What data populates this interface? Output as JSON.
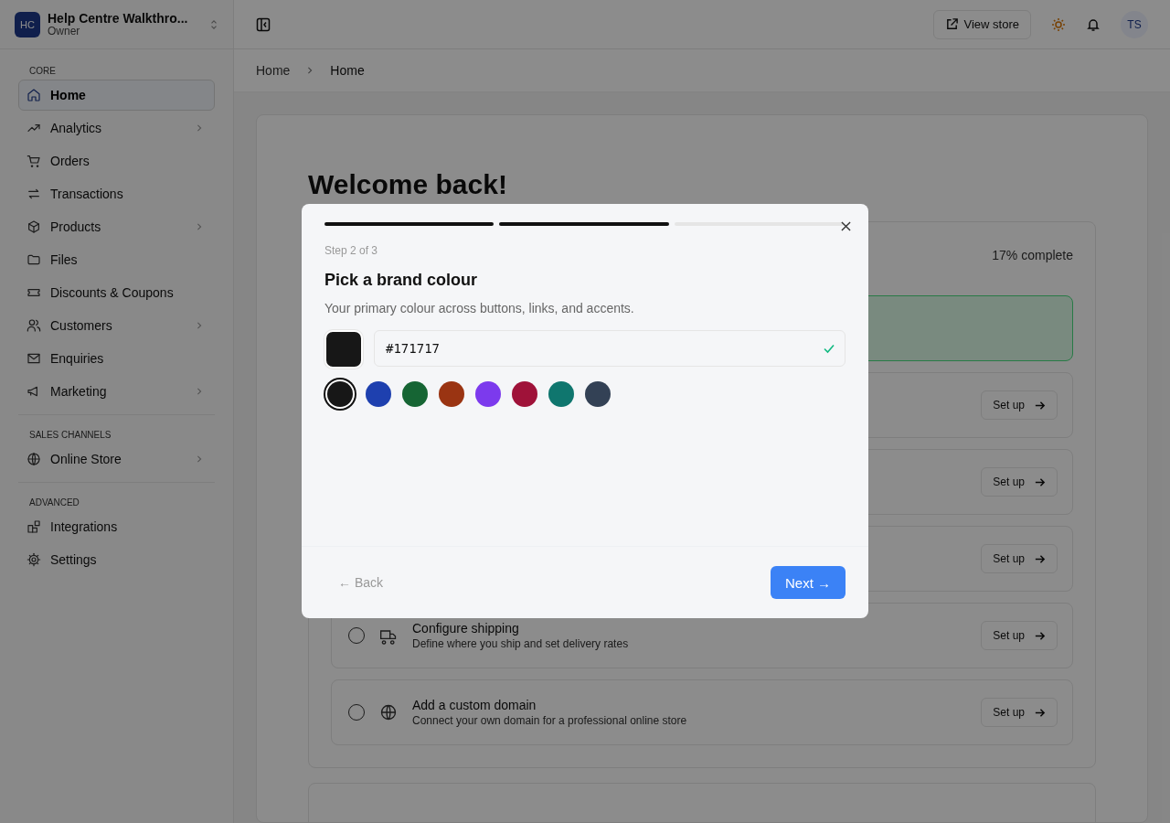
{
  "workspace": {
    "initials": "HC",
    "name": "Help Centre Walkthro...",
    "role": "Owner"
  },
  "sidebar": {
    "sections": [
      {
        "label": "CORE",
        "items": [
          {
            "label": "Home",
            "selected": true,
            "expandable": false
          },
          {
            "label": "Analytics",
            "selected": false,
            "expandable": true
          },
          {
            "label": "Orders",
            "selected": false,
            "expandable": false
          },
          {
            "label": "Transactions",
            "selected": false,
            "expandable": false
          },
          {
            "label": "Products",
            "selected": false,
            "expandable": true
          },
          {
            "label": "Files",
            "selected": false,
            "expandable": false
          },
          {
            "label": "Discounts & Coupons",
            "selected": false,
            "expandable": false
          },
          {
            "label": "Customers",
            "selected": false,
            "expandable": true
          },
          {
            "label": "Enquiries",
            "selected": false,
            "expandable": false
          },
          {
            "label": "Marketing",
            "selected": false,
            "expandable": true
          }
        ]
      },
      {
        "label": "SALES CHANNELS",
        "items": [
          {
            "label": "Online Store",
            "selected": false,
            "expandable": true
          }
        ]
      },
      {
        "label": "ADVANCED",
        "items": [
          {
            "label": "Integrations",
            "selected": false,
            "expandable": false
          },
          {
            "label": "Settings",
            "selected": false,
            "expandable": false
          }
        ]
      }
    ]
  },
  "header": {
    "view_store": "View store",
    "avatar": "TS"
  },
  "breadcrumb": [
    "Home",
    "Home"
  ],
  "main": {
    "title": "Welcome back!",
    "progress_text": "17% complete",
    "tasks": [
      {
        "done": true
      },
      {
        "done": false,
        "button": "Set up"
      },
      {
        "done": false,
        "button": "Set up"
      },
      {
        "done": false,
        "button": "Set up"
      },
      {
        "done": false,
        "title": "Configure shipping",
        "description": "Define where you ship and set delivery rates",
        "button": "Set up"
      },
      {
        "done": false,
        "title": "Add a custom domain",
        "description": "Connect your own domain for a professional online store",
        "button": "Set up"
      }
    ]
  },
  "dialog": {
    "steps": [
      {
        "filled": true
      },
      {
        "filled": true
      },
      {
        "filled": false
      }
    ],
    "step_label": "Step 2 of 3",
    "title": "Pick a brand colour",
    "description": "Your primary colour across buttons, links, and accents.",
    "hex_value": "#171717",
    "valid": true,
    "swatches": [
      {
        "color": "#171717",
        "selected": true
      },
      {
        "color": "#1e40af",
        "selected": false
      },
      {
        "color": "#166534",
        "selected": false
      },
      {
        "color": "#9a3412",
        "selected": false
      },
      {
        "color": "#7c3aed",
        "selected": false
      },
      {
        "color": "#9f1239",
        "selected": false
      },
      {
        "color": "#0f766e",
        "selected": false
      },
      {
        "color": "#334155",
        "selected": false
      }
    ],
    "back": "← Back",
    "next": "Next →"
  }
}
